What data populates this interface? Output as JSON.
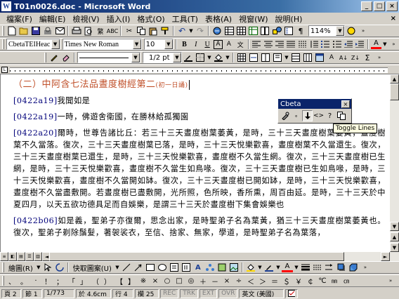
{
  "window": {
    "title": "T01n0026.doc - Microsoft Word",
    "app_icon_letter": "W",
    "minimize": "_",
    "maximize": "□",
    "close": "×"
  },
  "menu": {
    "items": [
      "檔案(F)",
      "編輯(E)",
      "檢視(V)",
      "插入(I)",
      "格式(O)",
      "工具(T)",
      "表格(A)",
      "視窗(W)",
      "說明(H)"
    ],
    "doc_close": "×"
  },
  "toolbar_standard": {
    "zoom": "114%"
  },
  "toolbar_format": {
    "style": "CbetaTEIHeac",
    "font": "Times New Roman",
    "size": "10",
    "bold": "B",
    "italic": "I",
    "underline": "U"
  },
  "toolbar_lines": {
    "weight": "1/2 pt"
  },
  "document": {
    "heading_main": "（二）中阿含七法品晝度樹經第二",
    "heading_small": "(初一日誦)",
    "paragraphs": [
      {
        "ref": "[0422a19]",
        "text": "我聞如是"
      },
      {
        "ref": "[0422a19]",
        "text": "一時，佛遊舍衛國，在勝林給孤獨園"
      },
      {
        "ref": "[0422a20]",
        "text": "爾時，世尊告諸比丘：若三十三天晝度樹葉萎黃，是時，三十三天晝度樹葉萎黃，晝度樹葉不久當落。復次，三十三天晝度樹葉已落，是時，三十三天悅樂歡喜，晝度樹葉不久當還生。復次，三十三天晝度樹葉已還生，是時，三十三天悅樂歡喜，晝度樹不久當生網。復次，三十三天晝度樹已生網，是時，三十三天悅樂歡喜，晝度樹不久當生如鳥喙。復次，三十三天晝度樹已生如鳥喙，是時，三十三天悅樂歡喜，晝度樹不久當開如缽。復次，三十三天晝度樹已開如缽，是時，三十三天悅樂歡喜，晝度樹不久當盡敷開。若晝度樹已盡敷開，光所照，色所映，香所熏，周百由延。是時，三十三天於中夏四月，以天五欲功德具足而自娛樂，是謂三十三天於晝度樹下集會娛樂也"
      },
      {
        "ref": "[0422b06]",
        "text": "如是義，聖弟子亦復爾，思念出家，是時聖弟子名為葉黃，猶三十三天晝度樹葉萎黃也。復次，聖弟子剃除鬚髮，著袈裟衣，至信、捨家、無家，學道，是時聖弟子名為葉落，"
      }
    ]
  },
  "cbeta_toolbar": {
    "title": "Cbeta",
    "tooltip": "Toggle Lines"
  },
  "drawing_toolbar": {
    "draw": "繪圖(R)",
    "autoshapes": "快取圖案(U)"
  },
  "statusbar": {
    "page": "頁 2",
    "section": "節 1",
    "page_of": "1/773",
    "at": "於 4.6cm",
    "line": "行 4",
    "column": "欄 25",
    "rec": "REC",
    "trk": "TRK",
    "ext": "EXT",
    "ovr": "OVR",
    "language": "英文 (美國)"
  }
}
